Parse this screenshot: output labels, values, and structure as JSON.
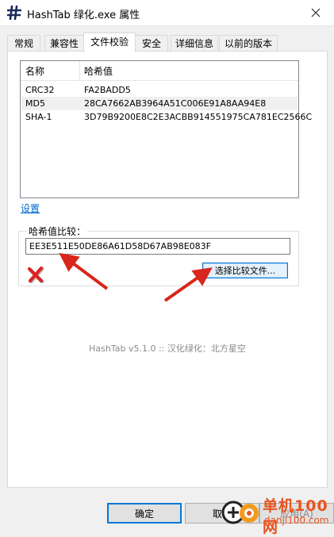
{
  "window": {
    "title": "HashTab 绿化.exe 属性",
    "close_icon": "close-icon",
    "app_icon": "hash-icon"
  },
  "tabs": [
    {
      "label": "常规",
      "active": false
    },
    {
      "label": "兼容性",
      "active": false
    },
    {
      "label": "文件校验",
      "active": true
    },
    {
      "label": "安全",
      "active": false
    },
    {
      "label": "详细信息",
      "active": false
    },
    {
      "label": "以前的版本",
      "active": false
    }
  ],
  "hash_table": {
    "columns": [
      "名称",
      "哈希值"
    ],
    "rows": [
      {
        "name": "CRC32",
        "value": "FA2BADD5",
        "selected": false
      },
      {
        "name": "MD5",
        "value": "28CA7662AB3964A51C006E91A8AA94E8",
        "selected": true
      },
      {
        "name": "SHA-1",
        "value": "3D79B9200E8C2E3ACBB914551975CA781EC2566C",
        "selected": false
      }
    ]
  },
  "settings_link": "设置",
  "compare": {
    "label": "哈希值比较：",
    "input_value": "EE3E511E50DE86A61D58D67AB98E083F",
    "mismatch_icon": "red-x-icon",
    "choose_file_button": "选择比较文件..."
  },
  "footer_credit": "HashTab v5.1.0 :: 汉化绿化：北方星空",
  "buttons": {
    "ok": "确定",
    "cancel": "取消",
    "apply": "应用(A)"
  },
  "watermark": {
    "line1": "单机100网",
    "line2": "danji100.com"
  },
  "colors": {
    "accent": "#0078d7",
    "link": "#0066cc",
    "annotation_arrow": "#d9261c",
    "watermark": "#e8531f"
  }
}
